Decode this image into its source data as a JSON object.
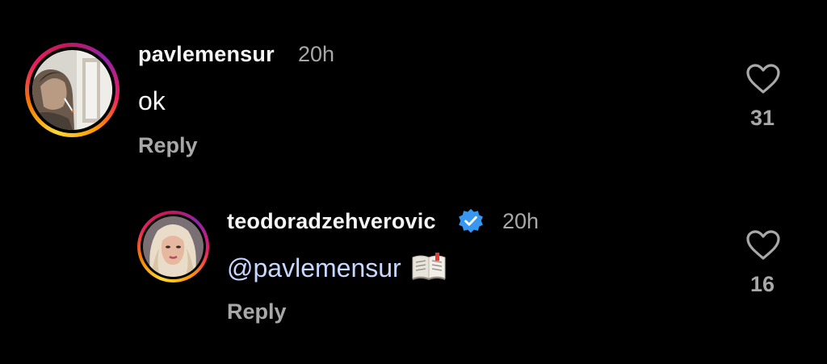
{
  "comments": [
    {
      "username": "pavlemensur",
      "time": "20h",
      "text": "ok",
      "reply_label": "Reply",
      "like_count": "31",
      "avatar": "avatar-photo-man-smoking",
      "verified": false
    },
    {
      "username": "teodoradzehverovic",
      "time": "20h",
      "mention": "@pavlemensur",
      "emoji": "open-book-icon",
      "reply_label": "Reply",
      "like_count": "16",
      "avatar": "avatar-photo-woman-blonde",
      "verified": true
    }
  ],
  "colors": {
    "background": "#000000",
    "text_primary": "#f5f5f5",
    "text_secondary": "#a8a8a8",
    "mention": "#c7d7ff",
    "verified_badge": "#3897f0"
  }
}
